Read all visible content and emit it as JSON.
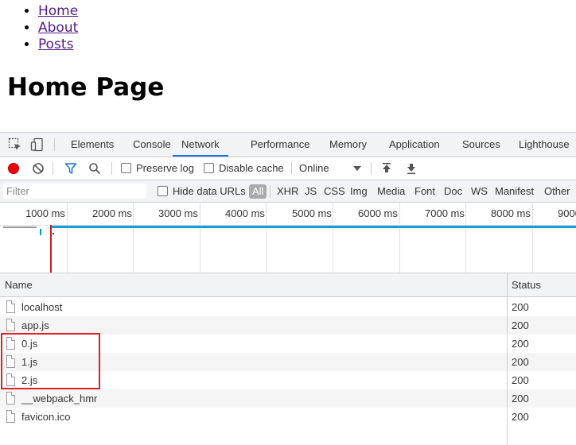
{
  "nav": {
    "links": [
      "Home",
      "About",
      "Posts"
    ]
  },
  "page": {
    "title": "Home Page"
  },
  "devtools": {
    "tabs": [
      "Elements",
      "Console",
      "Network",
      "Performance",
      "Memory",
      "Application",
      "Sources",
      "Lighthouse"
    ],
    "active_tab": "Network",
    "toolbar": {
      "preserve_log": "Preserve log",
      "disable_cache": "Disable cache",
      "throttling": "Online"
    },
    "filter": {
      "placeholder": "Filter",
      "hide_data_urls": "Hide data URLs",
      "types": [
        "All",
        "XHR",
        "JS",
        "CSS",
        "Img",
        "Media",
        "Font",
        "Doc",
        "WS",
        "Manifest",
        "Other"
      ]
    },
    "timeline": {
      "ticks": [
        "1000 ms",
        "2000 ms",
        "3000 ms",
        "4000 ms",
        "5000 ms",
        "6000 ms",
        "7000 ms",
        "8000 ms",
        "9000"
      ]
    },
    "table": {
      "columns": [
        "Name",
        "Status"
      ],
      "rows": [
        {
          "name": "localhost",
          "status": "200"
        },
        {
          "name": "app.js",
          "status": "200"
        },
        {
          "name": "0.js",
          "status": "200"
        },
        {
          "name": "1.js",
          "status": "200"
        },
        {
          "name": "2.js",
          "status": "200"
        },
        {
          "name": "__webpack_hmr",
          "status": "200"
        },
        {
          "name": "favicon.ico",
          "status": "200"
        }
      ]
    },
    "colors": {
      "record": "#ee0000",
      "accent": "#1a73e8",
      "highlight": "#e02020"
    }
  }
}
